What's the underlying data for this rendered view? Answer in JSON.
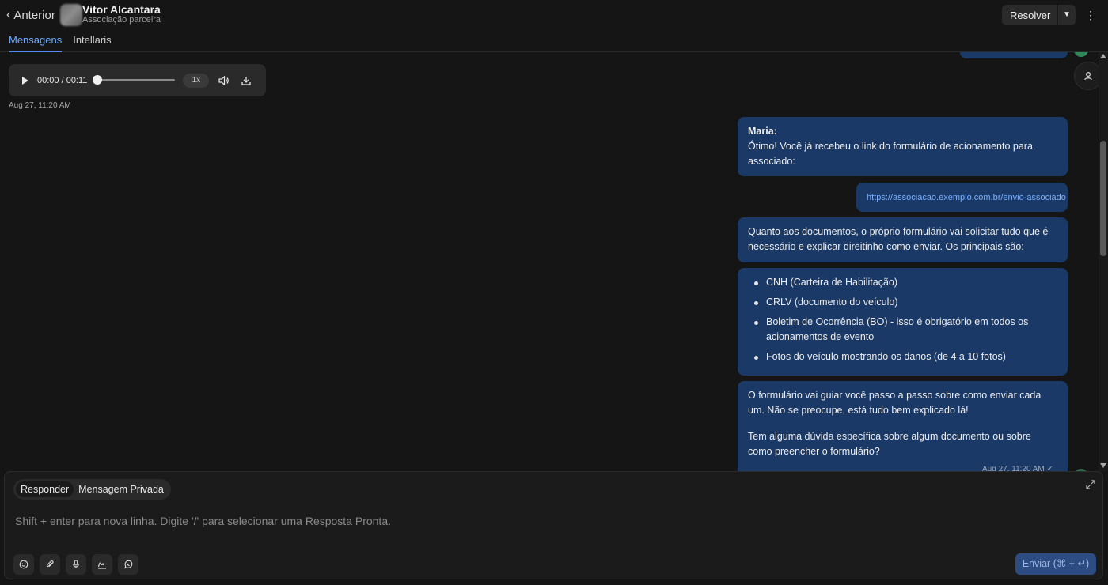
{
  "header": {
    "back_label": "Anterior",
    "contact_name": "Vitor Alcantara",
    "contact_subtitle": "Associação parceira",
    "tabs": [
      {
        "label": "Mensagens",
        "active": true
      },
      {
        "label": "Intellaris",
        "active": false
      }
    ],
    "resolve_label": "Resolver"
  },
  "audio": {
    "time": "00:00 / 00:11",
    "speed": "1x",
    "timestamp": "Aug 27, 11:20 AM"
  },
  "messages": {
    "m1_sender": "Maria:",
    "m1_text": "Ótimo! Você já recebeu o link do formulário de acionamento para associado:",
    "m2_link": "https://associacao.exemplo.com.br/envio-associado",
    "m3_text": "Quanto aos documentos, o próprio formulário vai solicitar tudo que é necessário e explicar direitinho como enviar. Os principais são:",
    "m4_items": [
      "CNH (Carteira de Habilitação)",
      "CRLV (documento do veículo)",
      "Boletim de Ocorrência (BO) - isso é obrigatório em todos os acionamentos de evento",
      "Fotos do veículo mostrando os danos (de 4 a 10 fotos)"
    ],
    "m5_p1": "O formulário vai guiar você passo a passo sobre como enviar cada um. Não se preocupe, está tudo bem explicado lá!",
    "m5_p2": "Tem alguma dúvida específica sobre algum documento ou sobre como preencher o formulário?",
    "m5_timestamp": "Aug 27, 11:20 AM ✓"
  },
  "composer": {
    "mode_reply": "Responder",
    "mode_private": "Mensagem Privada",
    "placeholder": "Shift + enter para nova linha. Digite '/' para selecionar uma Resposta Pronta.",
    "send_label": "Enviar (⌘ + ↵)"
  },
  "colors": {
    "accent": "#4f8ef5",
    "bubble": "#1a3966",
    "background": "#151515"
  }
}
